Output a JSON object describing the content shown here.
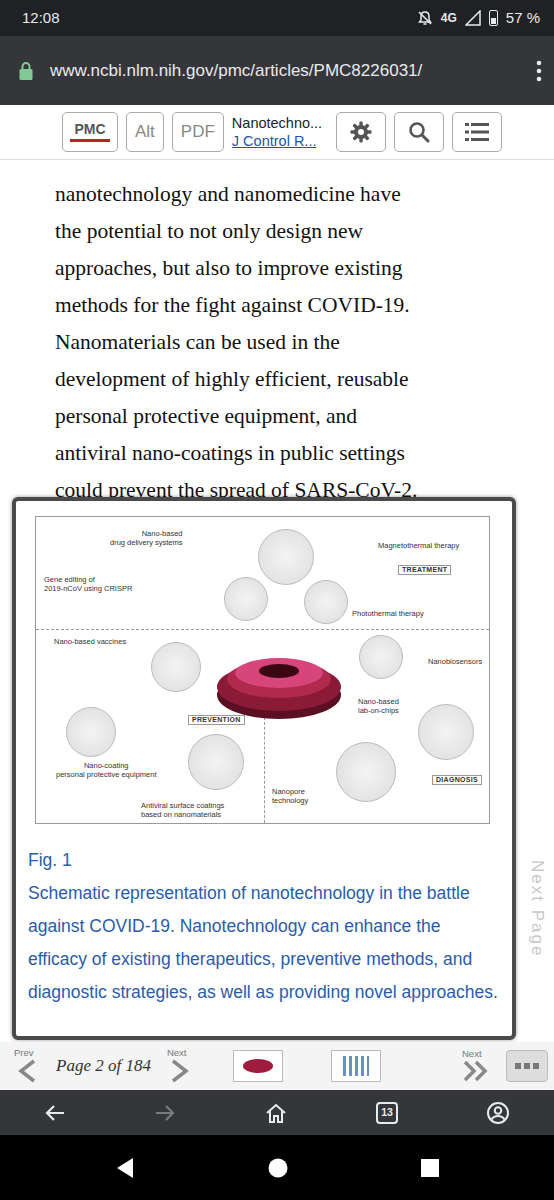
{
  "status_bar": {
    "time": "12:08",
    "network": "4G",
    "battery": "57 %",
    "battery_level": 0.57
  },
  "browser": {
    "url": "www.ncbi.nlm.nih.gov/pmc/articles/PMC8226031/",
    "tab_count": "13",
    "forward_disabled": true
  },
  "toolbar": {
    "logo": "PMC",
    "buttons": [
      "Alt",
      "PDF"
    ],
    "title": "Nanotechno...",
    "journal": "J Control R..."
  },
  "article": {
    "lines": [
      "nanotechnology and nanomedicine have",
      "the potential to not only design new",
      "approaches, but also to improve existing",
      "methods for the fight against COVID-19.",
      "Nanomaterials can be used in the",
      "development of highly efficient, reusable",
      "personal protective equipment, and",
      "antiviral nano-coatings in public settings",
      "could prevent the spread of SARS-CoV-2."
    ]
  },
  "figure": {
    "labels": [
      {
        "text": "Nano-based\ndrug delivery systems",
        "kind": "label"
      },
      {
        "text": "Magnetothermal therapy",
        "kind": "label"
      },
      {
        "text": "TREATMENT",
        "kind": "section"
      },
      {
        "text": "Gene editing of\n2019-nCoV using CRISPR",
        "kind": "label"
      },
      {
        "text": "Photothermal therapy",
        "kind": "label"
      },
      {
        "text": "Nano-based vaccines",
        "kind": "label"
      },
      {
        "text": "Nanobiosensors",
        "kind": "label"
      },
      {
        "text": "PREVENTION",
        "kind": "section"
      },
      {
        "text": "Nano-based\nlab-on-chips",
        "kind": "label"
      },
      {
        "text": "Nano-coating\npersonal protective equipment",
        "kind": "label"
      },
      {
        "text": "DIAGNOSIS",
        "kind": "section"
      },
      {
        "text": "Nanopore\ntechnology",
        "kind": "label"
      },
      {
        "text": "Antiviral surface coatings\nbased on nanomaterials",
        "kind": "label"
      }
    ],
    "title": "Fig. 1",
    "caption": "Schematic representation of nanotechnology in the battle against COVID-19. Nanotechnology can enhance the efficacy of existing therapeutics, preventive methods, and diagnostic strategies, as well as providing novel approaches."
  },
  "side_nav": {
    "next": "Next Page"
  },
  "pager": {
    "prev": "Prev",
    "page": "Page 2 of 184",
    "next": "Next",
    "next_end": "Next"
  }
}
